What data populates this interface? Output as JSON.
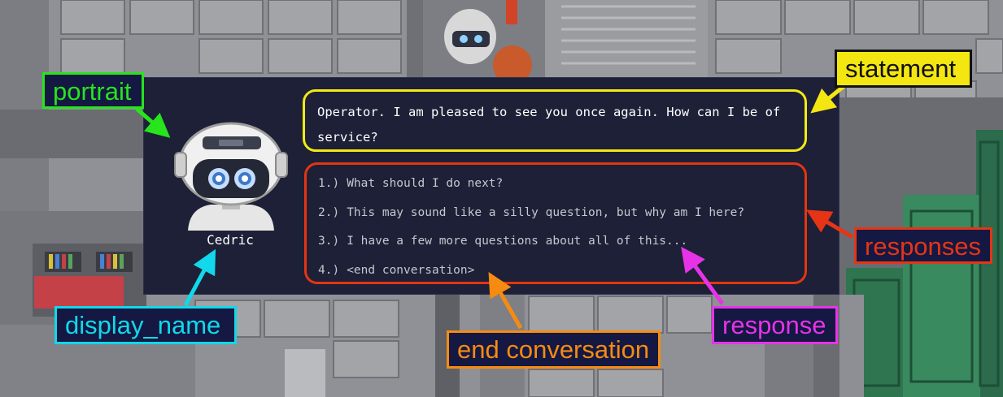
{
  "dialog": {
    "display_name": "Cedric",
    "statement": "Operator. I am pleased to see you once again. How can I be of service?",
    "responses": [
      {
        "number": "1.)",
        "text": "What should I do next?"
      },
      {
        "number": "2.)",
        "text": "This may sound like a silly question, but why am I here?"
      },
      {
        "number": "3.)",
        "text": "I have a few more questions about all of this..."
      },
      {
        "number": "4.)",
        "text": "<end conversation>"
      }
    ]
  },
  "annotations": {
    "portrait": "portrait",
    "statement": "statement",
    "responses": "responses",
    "display_name": "display_name",
    "end_conversation": "end conversation",
    "response": "response"
  },
  "colors": {
    "dialog_bg": "#1d2036",
    "statement_border": "#f2ea13",
    "responses_border": "#e43512",
    "portrait_label": "#27e41d",
    "display_name_label": "#11d8ea",
    "end_conversation_label": "#f68b12",
    "response_label": "#e733e7"
  },
  "icons": {
    "portrait": "robot-portrait",
    "arrows": "annotation-arrow"
  }
}
